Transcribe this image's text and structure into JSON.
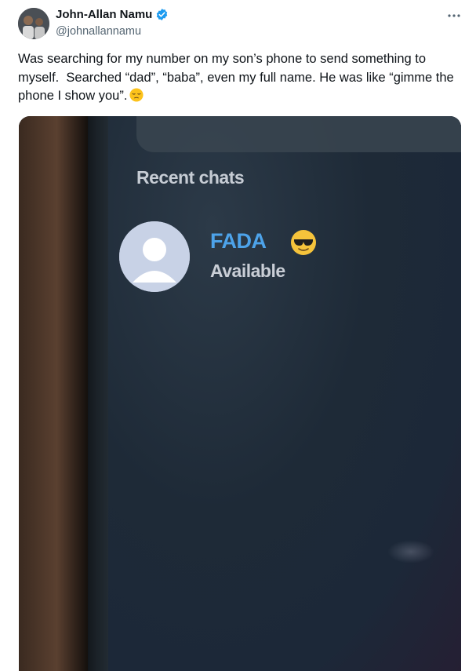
{
  "tweet": {
    "author": {
      "display_name": "John-Allan Namu",
      "handle": "@johnallannamu",
      "verified_icon": "verified-badge-icon",
      "verified_color": "#1d9bf0"
    },
    "more_icon": "more-options-icon",
    "text": "Was searching for my number on my son’s phone to send something to myself.  Searched “dad”, “baba”, even my full name. He was like “gimme the phone I show you”.",
    "text_emoji": "pensive-face-emoji"
  },
  "photo": {
    "recent_chats_title": "Recent chats",
    "chat": {
      "contact_name": "FADA",
      "contact_emoji": "sunglasses-face-emoji",
      "status": "Available",
      "avatar_icon": "default-person-avatar-icon"
    },
    "name_color": "#4da3ea"
  }
}
